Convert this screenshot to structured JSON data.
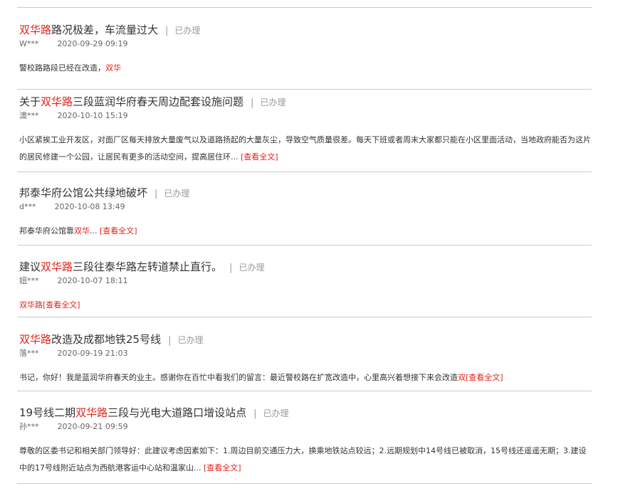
{
  "status_label": "已办理",
  "separator": "|",
  "more_label": "[查看全文]",
  "colors": {
    "highlight": "#e2231a",
    "status": "#9a9a9a",
    "rule": "#c9c9c9"
  },
  "items": [
    {
      "title": {
        "a": "",
        "hl": "双华路",
        "b": "路况极差，车流量过大"
      },
      "author": "W***",
      "date": "2020-09-29 09:19",
      "body": {
        "a": "警校路路段已经在改造，",
        "hl": "双华",
        "b": ""
      }
    },
    {
      "title": {
        "a": "关于",
        "hl": "双华路",
        "b": "三段蓝润华府春天周边配套设施问题"
      },
      "author": "澳***",
      "date": "2020-10-10 15:19",
      "body": {
        "a": "小区紧挨工业开发区，对面厂区每天排放大量废气以及道路扬起的大量灰尘，导致空气质量很差。每天下班或者周末大家都只能在小区里面活动，当地政府能否为这片的居民修建一个公园，让居民有更多的活动空间，提高居住环... ",
        "hl": "",
        "b": ""
      }
    },
    {
      "title": {
        "a": "邦泰华府公馆公共绿地破坏",
        "hl": "",
        "b": ""
      },
      "author": "d***",
      "date": "2020-10-08 13:49",
      "body": {
        "a": "邦泰华府公馆靠",
        "hl": "双华",
        "b": "... "
      }
    },
    {
      "title": {
        "a": "建议",
        "hl": "双华路",
        "b": "三段往泰华路左转道禁止直行。"
      },
      "author": "妞***",
      "date": "2020-10-07 18:11",
      "body": {
        "a": "",
        "hl": "双华路",
        "b": ""
      }
    },
    {
      "title": {
        "a": "",
        "hl": "双华路",
        "b": "改造及成都地铁25号线"
      },
      "author": "落***",
      "date": "2020-09-19 21:03",
      "body": {
        "a": "书记，你好！我是蓝润华府春天的业主。感谢你在百忙中看我们的留言：最近警校路在扩宽改造中，心里高兴着想接下来会改造",
        "hl": "双",
        "b": ""
      }
    },
    {
      "title": {
        "a": "19号线二期",
        "hl": "双华路",
        "b": "三段与光电大道路口增设站点"
      },
      "author": "孙***",
      "date": "2020-09-21 09:59",
      "body": {
        "a": "尊敬的区委书记和相关部门领导好：此建议考虑因素如下：1.周边目前交通压力大，换乘地铁站点较远；2.远期规划中14号线已被取消，15号线还遥遥无期；3.建设中的17号线附近站点为西航港客运中心站和温家山... ",
        "hl": "",
        "b": ""
      }
    }
  ]
}
